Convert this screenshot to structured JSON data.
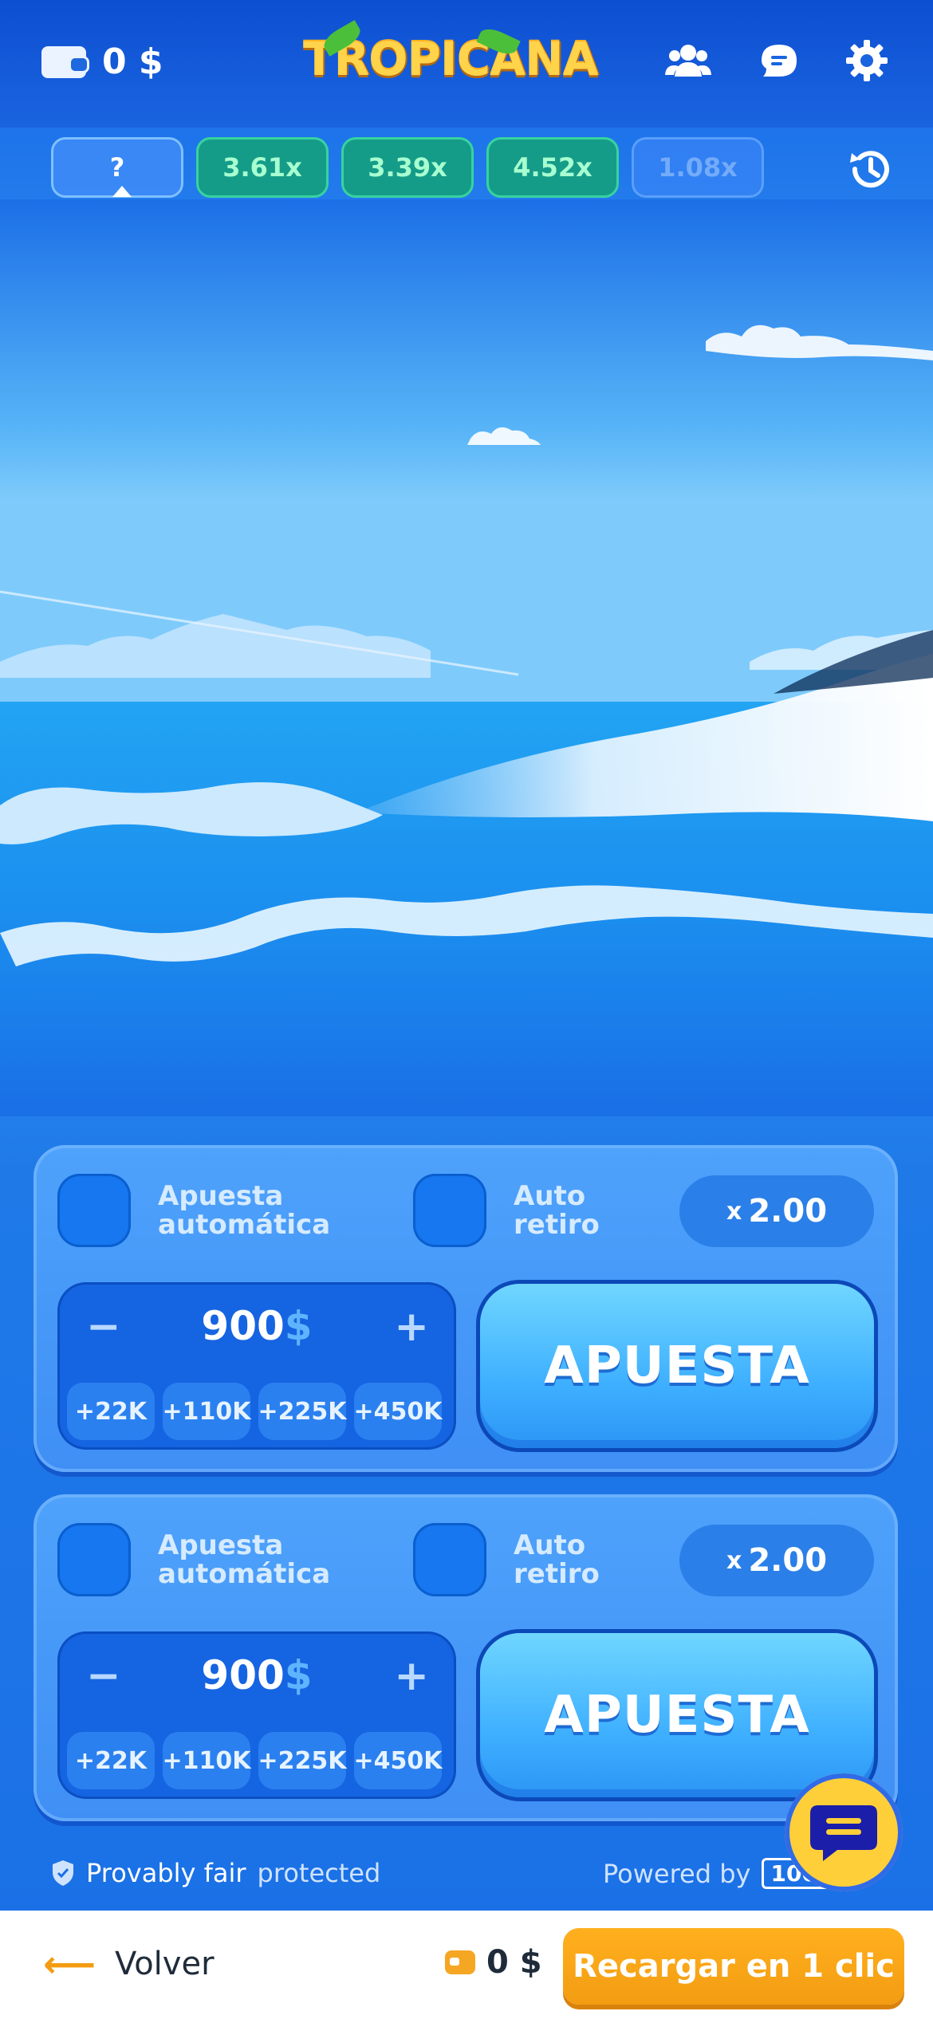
{
  "header": {
    "balance": "0 $",
    "logo_text": "TROPICANA"
  },
  "multipliers": {
    "pending": "?",
    "history": [
      "3.61x",
      "3.39x",
      "4.52x",
      "1.08x"
    ]
  },
  "panels": [
    {
      "auto_bet_label": "Apuesta automática",
      "auto_cashout_label": "Auto retiro",
      "cashout_prefix": "x",
      "cashout_value": "2.00",
      "minus": "−",
      "plus": "+",
      "amount": "900",
      "currency": "$",
      "quick_amounts": [
        "+22K",
        "+110K",
        "+225K",
        "+450K"
      ],
      "bet_label": "APUESTA"
    },
    {
      "auto_bet_label": "Apuesta automática",
      "auto_cashout_label": "Auto retiro",
      "cashout_prefix": "x",
      "cashout_value": "2.00",
      "minus": "−",
      "plus": "+",
      "amount": "900",
      "currency": "$",
      "quick_amounts": [
        "+22K",
        "+110K",
        "+225K",
        "+450K"
      ],
      "bet_label": "APUESTA"
    }
  ],
  "footer": {
    "fair_bold": "Provably fair",
    "fair_light": "protected",
    "powered_by": "Powered by",
    "provider": "100HP"
  },
  "bottom_bar": {
    "back_arrow": "⟵",
    "back_label": "Volver",
    "balance": "0 $",
    "reload_label": "Recargar en 1 clic"
  },
  "colors": {
    "accent_orange": "#f39c12",
    "multiplier_green": "#159c88",
    "panel_blue": "#4ea2fb",
    "chat_yellow": "#ffcf3a"
  }
}
